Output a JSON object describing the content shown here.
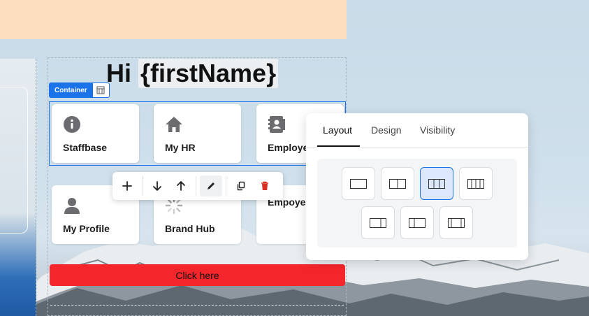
{
  "greeting": {
    "hi": "Hi",
    "variable": "{firstName}"
  },
  "container_tag": {
    "label": "Container"
  },
  "tiles": [
    {
      "label": "Staffbase",
      "icon": "info-icon"
    },
    {
      "label": "My HR",
      "icon": "home-icon"
    },
    {
      "label": "Employe",
      "icon": "contacts-book-icon"
    },
    {
      "label": "My Profile",
      "icon": "person-icon"
    },
    {
      "label": "Brand Hub",
      "icon": "spinner-icon"
    },
    {
      "label": "Empoye",
      "icon": ""
    }
  ],
  "cta": {
    "label": "Click here",
    "color": "#f5262b"
  },
  "toolbar": {
    "items": [
      "add-icon",
      "move-down-icon",
      "move-up-icon",
      "edit-icon",
      "duplicate-icon",
      "delete-icon"
    ]
  },
  "panel": {
    "tabs": [
      {
        "label": "Layout",
        "active": true
      },
      {
        "label": "Design",
        "active": false
      },
      {
        "label": "Visibility",
        "active": false
      }
    ],
    "layout_options": [
      {
        "name": "one-column",
        "selected": false
      },
      {
        "name": "two-columns",
        "selected": false
      },
      {
        "name": "three-columns",
        "selected": true
      },
      {
        "name": "four-columns",
        "selected": false
      },
      {
        "name": "wide-left",
        "selected": false
      },
      {
        "name": "wide-right",
        "selected": false
      },
      {
        "name": "wide-center",
        "selected": false
      }
    ]
  },
  "colors": {
    "accent": "#1a73e8",
    "peach": "#fddfc0",
    "delete": "#d93025"
  }
}
